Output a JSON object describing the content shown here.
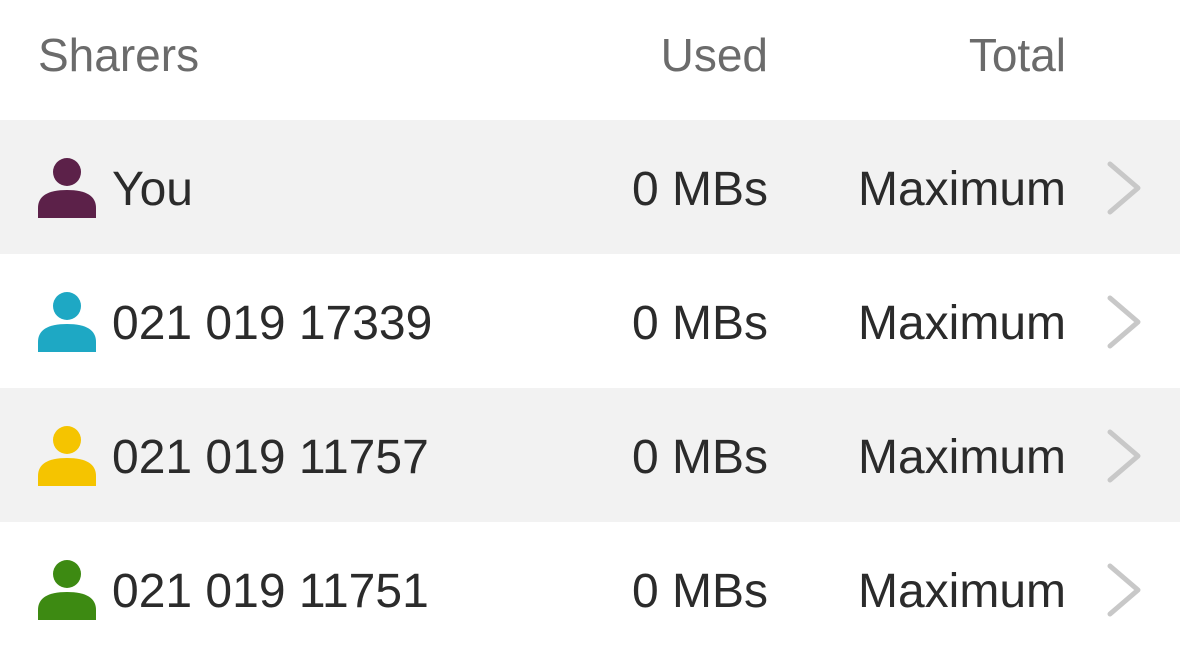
{
  "header": {
    "sharers_label": "Sharers",
    "used_label": "Used",
    "total_label": "Total"
  },
  "rows": [
    {
      "name": "You",
      "used": "0 MBs",
      "total": "Maximum",
      "avatar_color": "#5c2149",
      "avatar_icon": "person-icon",
      "chevron_icon": "chevron-right-icon"
    },
    {
      "name": "021 019 17339",
      "used": "0 MBs",
      "total": "Maximum",
      "avatar_color": "#1ea8c4",
      "avatar_icon": "person-icon",
      "chevron_icon": "chevron-right-icon"
    },
    {
      "name": "021 019 11757",
      "used": "0 MBs",
      "total": "Maximum",
      "avatar_color": "#f5c400",
      "avatar_icon": "person-icon",
      "chevron_icon": "chevron-right-icon"
    },
    {
      "name": "021 019 11751",
      "used": "0 MBs",
      "total": "Maximum",
      "avatar_color": "#3d8a12",
      "avatar_icon": "person-icon",
      "chevron_icon": "chevron-right-icon"
    }
  ],
  "colors": {
    "row_shaded": "#f2f2f2",
    "header_text": "#6b6b6b",
    "body_text": "#2b2b2b",
    "chevron": "#c8c8c8"
  }
}
